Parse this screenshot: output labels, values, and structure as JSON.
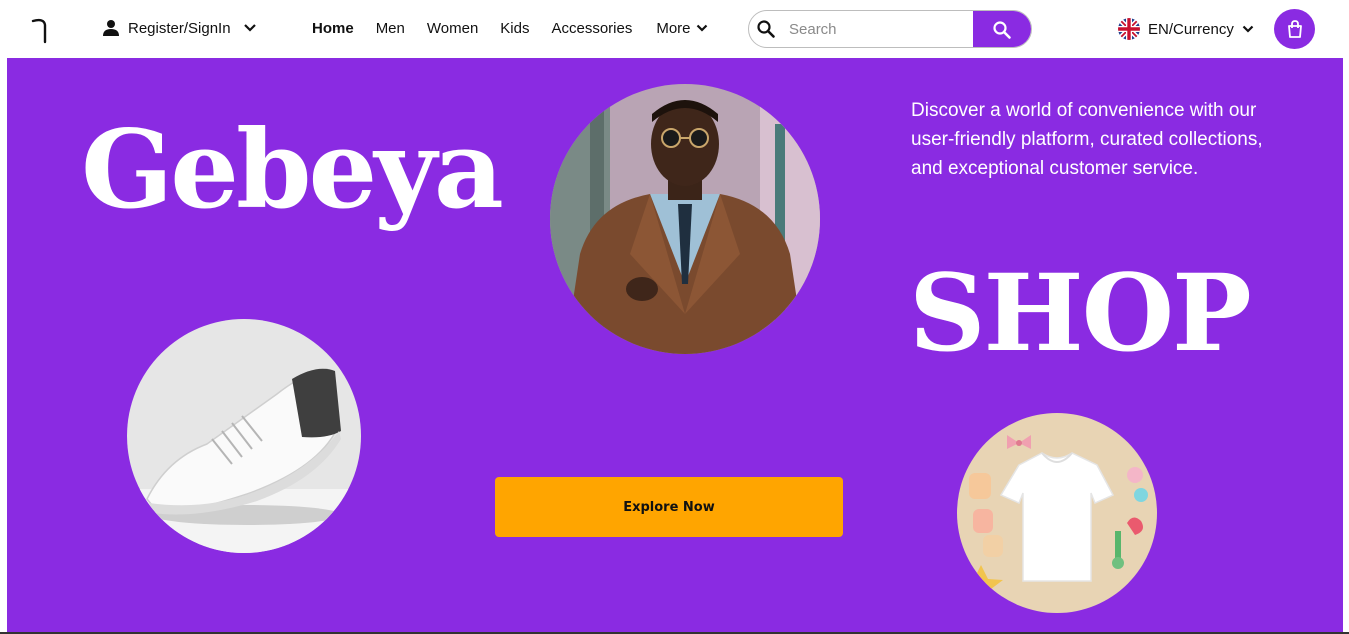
{
  "nav": {
    "logo_icon": "hook-logo-icon",
    "account": {
      "icon": "person-icon",
      "label": "Register/SignIn",
      "chevron": "chevron-down-icon"
    },
    "links": [
      {
        "label": "Home",
        "active": true
      },
      {
        "label": "Men",
        "active": false
      },
      {
        "label": "Women",
        "active": false
      },
      {
        "label": "Kids",
        "active": false
      },
      {
        "label": "Accessories",
        "active": false
      }
    ],
    "more": {
      "label": "More",
      "chevron": "chevron-down-icon"
    },
    "search": {
      "placeholder": "Search",
      "value": "",
      "icon": "search-icon",
      "button_icon": "search-icon"
    },
    "language": {
      "flag": "uk-flag-icon",
      "label": "EN/Currency",
      "chevron": "chevron-down-icon"
    },
    "cart_icon": "shopping-bag-icon"
  },
  "hero": {
    "title_left": "Gebeya",
    "title_right": "SHOP",
    "tagline": "Discover a world of convenience with our user-friendly platform, curated collections, and exceptional customer service.",
    "cta_label": "Explore Now",
    "images": [
      "man-in-leather-jacket-photo",
      "sneaker-photo",
      "kids-clothing-photo"
    ]
  },
  "colors": {
    "brand": "#8a2be2",
    "accent": "#ffa500",
    "text": "#111111",
    "hero_text": "#ffffff"
  }
}
